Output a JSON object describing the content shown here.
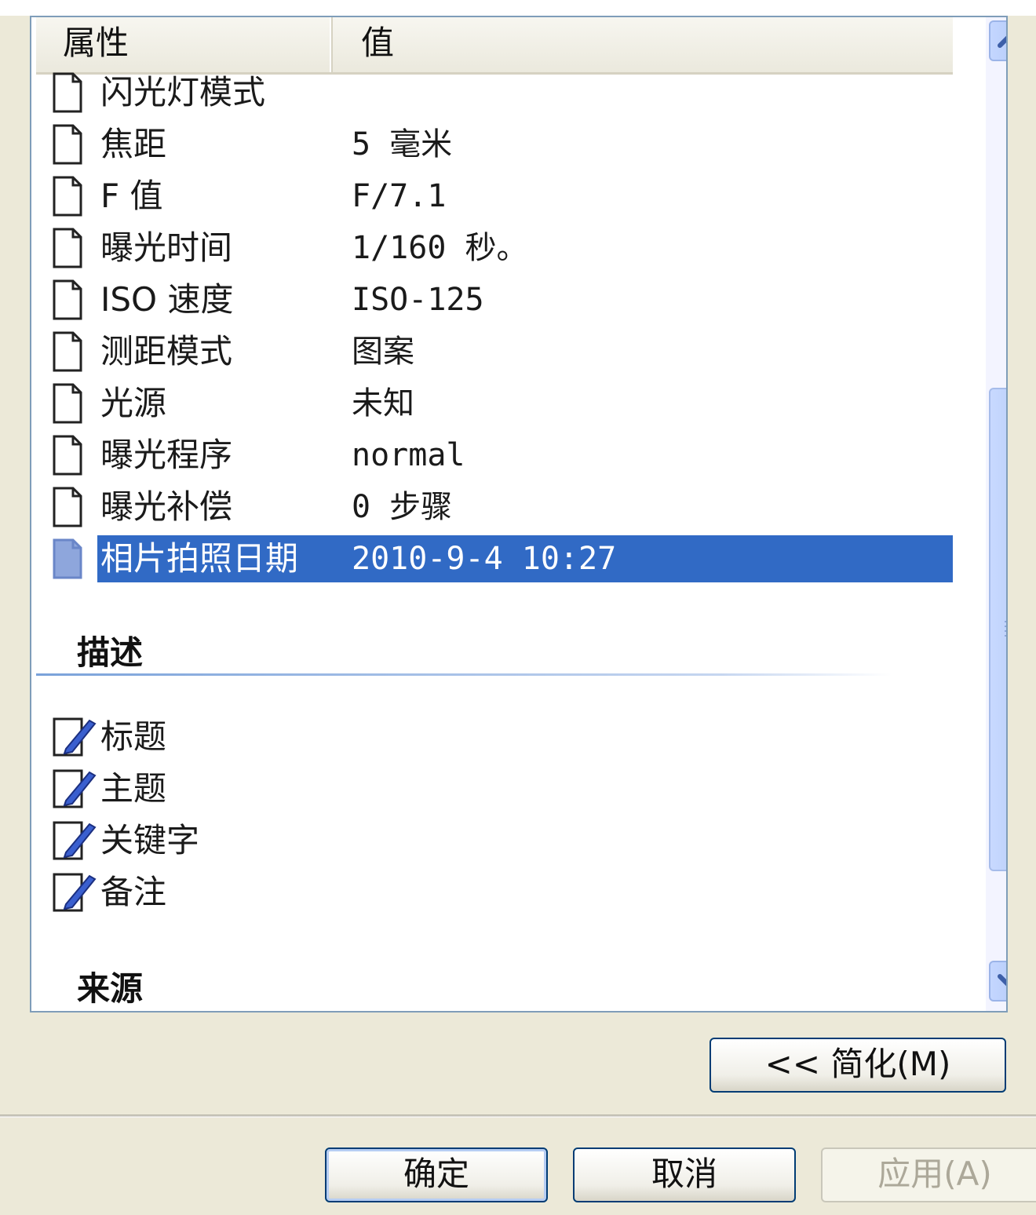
{
  "list": {
    "header": {
      "property": "属性",
      "value": "值"
    },
    "rows": [
      {
        "property": "闪光灯模式",
        "value": ""
      },
      {
        "property": "焦距",
        "value": "5 毫米"
      },
      {
        "property": "F 值",
        "value": "F/7.1"
      },
      {
        "property": "曝光时间",
        "value": "1/160 秒。"
      },
      {
        "property": "ISO 速度",
        "value": "ISO-125"
      },
      {
        "property": "测距模式",
        "value": "图案"
      },
      {
        "property": "光源",
        "value": "未知"
      },
      {
        "property": "曝光程序",
        "value": "normal"
      },
      {
        "property": "曝光补偿",
        "value": "0 步骤"
      },
      {
        "property": "相片拍照日期",
        "value": "2010-9-4 10:27",
        "selected": true
      }
    ],
    "sections": {
      "description": {
        "title": "描述",
        "items": [
          "标题",
          "主题",
          "关键字",
          "备注"
        ]
      },
      "source": {
        "title": "来源"
      }
    }
  },
  "buttons": {
    "simplify": "<< 简化(M)",
    "ok": "确定",
    "cancel": "取消",
    "apply": "应用(A)",
    "apply_enabled": false
  },
  "colors": {
    "selection": "#316ac5",
    "scrollbar": "#b6ccf7",
    "button_border": "#003c74"
  }
}
